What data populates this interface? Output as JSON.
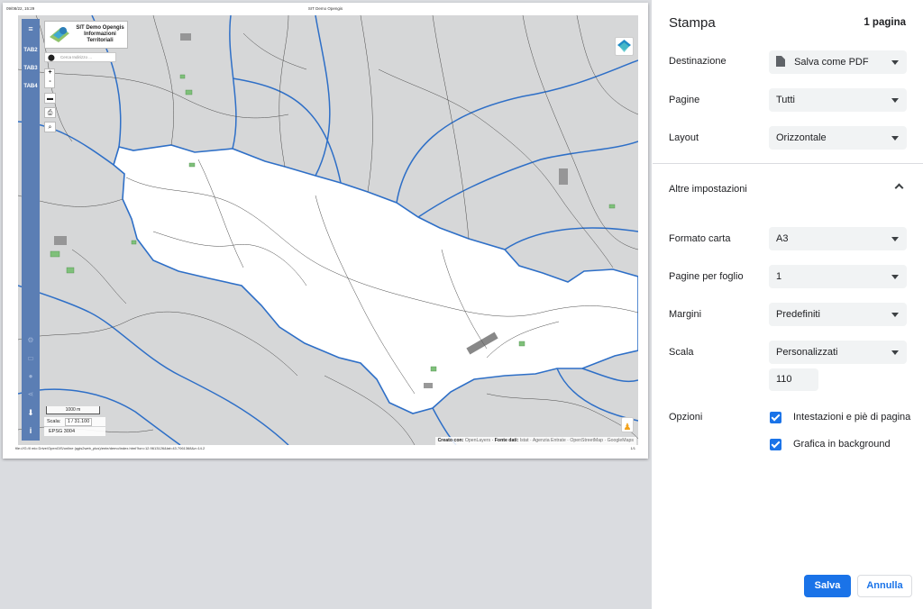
{
  "preview": {
    "header_date": "09/08/22, 15:29",
    "header_title": "SIT Demo Opengis",
    "footer_url": "file:///G:/Il mio Drive/OpenGIS/online (qgis2web_plus)/ente/demo/index.html?lon=12.9613126&lat=43.7061368&z=14.2",
    "footer_page": "1/1",
    "toolbar": {
      "menu_icon": "menu-icon",
      "tabs": [
        "TAB2",
        "TAB3",
        "TAB4"
      ]
    },
    "logo": {
      "line1": "SIT Demo Opengis",
      "line2": "Informazioni",
      "line3": "Territoriali"
    },
    "address_search": {
      "placeholder": "Cerca Indirizzo ..."
    },
    "zoom": {
      "in": "+",
      "out": "-"
    },
    "scalebar_label": "1000 m",
    "scale": {
      "label": "Scala:",
      "value": "1 / 31.100"
    },
    "epsg": "EPSG 3004",
    "attribution": {
      "created_with": "Creato con:",
      "openlayers": "OpenLayers",
      "sources_label": "Fonte dati:",
      "sources": "Istat · Agenzia Entrate · OpenStreetMap · GoogleMaps"
    },
    "colors": {
      "toolbar": "#5b7eb4",
      "map_background": "#d6d7d8",
      "boundary": "#2e6fc7"
    }
  },
  "panel": {
    "title": "Stampa",
    "page_count": "1 pagina",
    "destination": {
      "label": "Destinazione",
      "value": "Salva come PDF"
    },
    "pages": {
      "label": "Pagine",
      "value": "Tutti"
    },
    "layout": {
      "label": "Layout",
      "value": "Orizzontale"
    },
    "more_settings": "Altre impostazioni",
    "paper_size": {
      "label": "Formato carta",
      "value": "A3"
    },
    "pages_per_sheet": {
      "label": "Pagine per foglio",
      "value": "1"
    },
    "margins": {
      "label": "Margini",
      "value": "Predefiniti"
    },
    "scale": {
      "label": "Scala",
      "value": "Personalizzati",
      "custom_value": "110"
    },
    "options": {
      "label": "Opzioni",
      "headers_footers": {
        "label": "Intestazioni e piè di pagina",
        "checked": true
      },
      "background_graphics": {
        "label": "Grafica in background",
        "checked": true
      }
    },
    "save_button": "Salva",
    "cancel_button": "Annulla",
    "colors": {
      "primary": "#1a73e8",
      "select_bg": "#f1f3f4"
    }
  }
}
